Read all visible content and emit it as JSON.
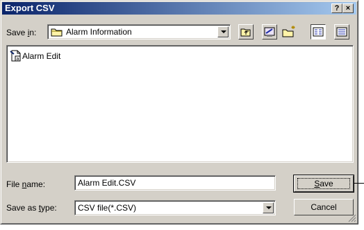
{
  "window": {
    "title": "Export CSV",
    "help_label": "?",
    "close_label": "×"
  },
  "save_in": {
    "label_prefix": "Save ",
    "label_mnemonic": "i",
    "label_suffix": "n:",
    "value": "Alarm Information"
  },
  "files": [
    {
      "name": "Alarm Edit"
    }
  ],
  "file_name": {
    "label_prefix": "File ",
    "label_mnemonic": "n",
    "label_suffix": "ame:",
    "value": "Alarm Edit.CSV"
  },
  "save_as_type": {
    "label_prefix": "Save as ",
    "label_mnemonic": "t",
    "label_suffix": "ype:",
    "value": "CSV file(*.CSV)"
  },
  "buttons": {
    "save_mnemonic": "S",
    "save_rest": "ave",
    "cancel": "Cancel"
  },
  "icons": {
    "folder": "folder-icon",
    "up": "up-one-level-icon",
    "desktop": "desktop-icon",
    "new_folder": "new-folder-icon",
    "list": "list-view-icon",
    "details": "details-view-icon",
    "file": "csv-file-icon"
  }
}
